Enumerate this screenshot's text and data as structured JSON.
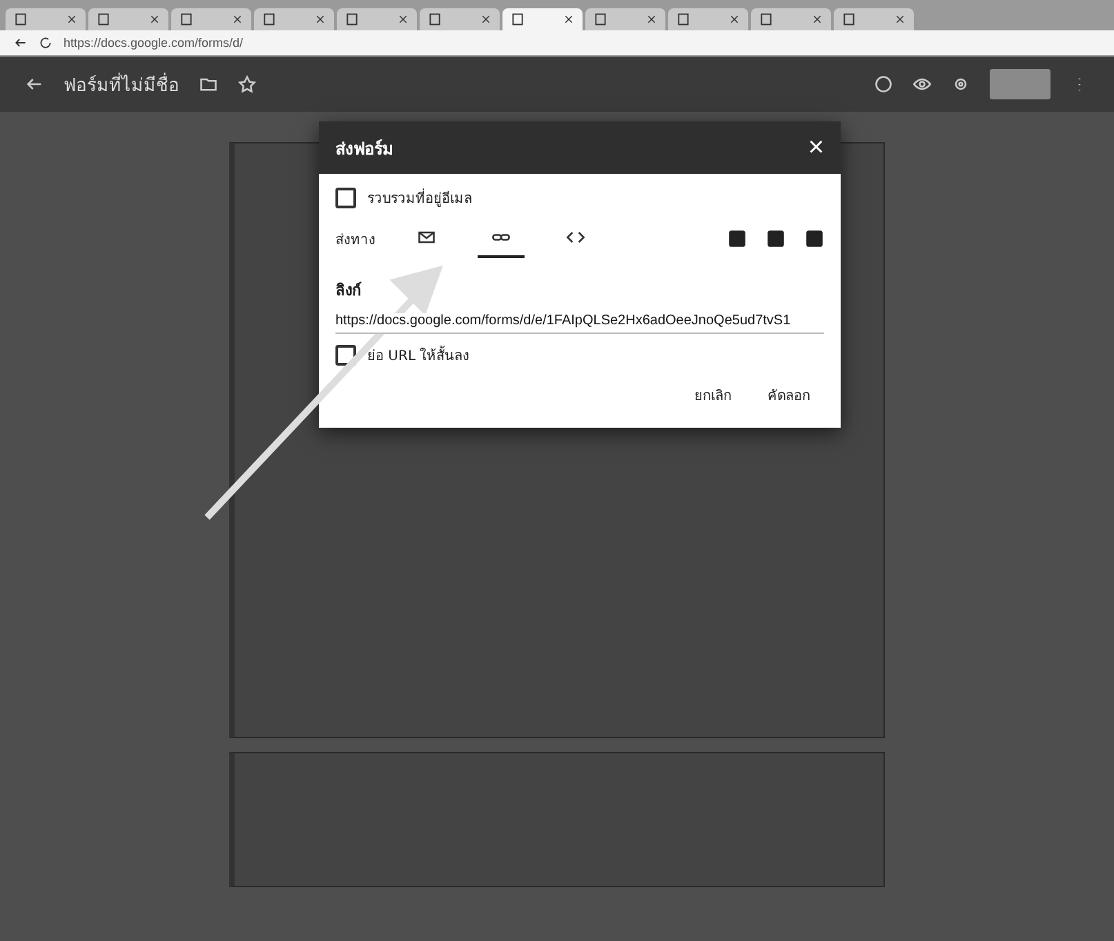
{
  "browser": {
    "tabs": [
      {
        "selected": false
      },
      {
        "selected": false
      },
      {
        "selected": false
      },
      {
        "selected": false
      },
      {
        "selected": false
      },
      {
        "selected": false
      },
      {
        "selected": true
      },
      {
        "selected": false
      },
      {
        "selected": false
      },
      {
        "selected": false
      },
      {
        "selected": false
      }
    ],
    "address": "https://docs.google.com/forms/d/"
  },
  "app_bar": {
    "title": "ฟอร์มที่ไม่มีชื่อ"
  },
  "dialog": {
    "title": "ส่งฟอร์ม",
    "close": "×",
    "collect_emails": {
      "label": "รวบรวมที่อยู่อีเมล",
      "checked": false
    },
    "send_via_label": "ส่งทาง",
    "methods": [
      {
        "kind": "email",
        "selected": false
      },
      {
        "kind": "link",
        "selected": true
      },
      {
        "kind": "embed",
        "selected": false
      }
    ],
    "section_title": "ลิงก์",
    "link": "https://docs.google.com/forms/d/e/1FAIpQLSe2Hx6adOeeJnoQe5ud7tvS1",
    "shorten": {
      "label": "ย่อ URL ให้สั้นลง",
      "checked": false
    },
    "buttons": [
      "ยกเลิก",
      "คัดลอก"
    ]
  }
}
